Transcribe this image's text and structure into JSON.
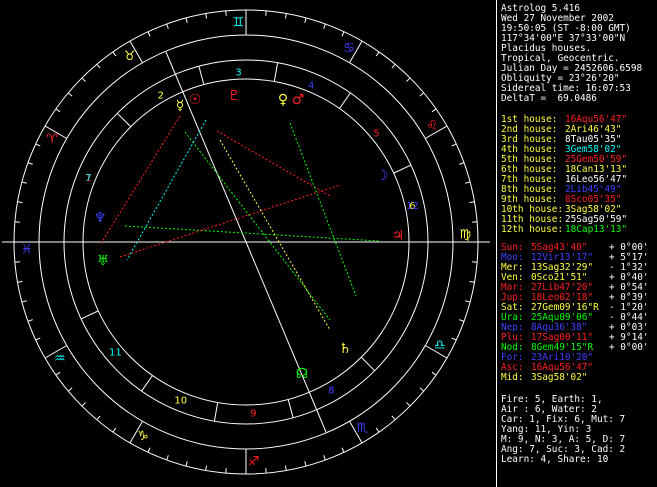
{
  "info_lines": [
    "Astrolog 5.416",
    "Wed 27 November 2002",
    "19:50:05 (ST -8:00 GMT)",
    "117°34'00\"E 37°33'00\"N",
    "Placidus houses.",
    "Tropical, Geocentric.",
    "Julian Day = 2452606.6598",
    "Obliquity = 23°26'20\"",
    "Sidereal time: 16:07:53",
    "DeltaT =  69.0486"
  ],
  "houses": [
    {
      "label": "1st house:",
      "value": "16Aqu56'47\"",
      "color": "#ff2020"
    },
    {
      "label": "2nd house:",
      "value": "2Ari46'43\"",
      "color": "#ffff40"
    },
    {
      "label": "3rd house:",
      "value": "8Tau05'35\"",
      "color": "#ffffff"
    },
    {
      "label": "4th house:",
      "value": "3Gem58'02\"",
      "color": "#00ffff"
    },
    {
      "label": "5th house:",
      "value": "25Gem50'59\"",
      "color": "#ff2020"
    },
    {
      "label": "6th house:",
      "value": "18Can13'13\"",
      "color": "#ffff40"
    },
    {
      "label": "7th house:",
      "value": "16Leo56'47\"",
      "color": "#ffffff"
    },
    {
      "label": "8th house:",
      "value": "2Lib45'49\"",
      "color": "#4040ff"
    },
    {
      "label": "9th house:",
      "value": "8Sco05'35\"",
      "color": "#ff2020"
    },
    {
      "label": "10th house:",
      "value": "3Sag58'02\"",
      "color": "#ffff40"
    },
    {
      "label": "11th house:",
      "value": "25Sag50'59\"",
      "color": "#ffffff"
    },
    {
      "label": "12th house:",
      "value": "18Cap13'13\"",
      "color": "#00ff00"
    }
  ],
  "planets": [
    {
      "name": "Sun:",
      "pos": "5Sag43'40\"",
      "lat": "+ 0°00'",
      "color": "#ff2020"
    },
    {
      "name": "Moo:",
      "pos": "12Vir13'17\"",
      "lat": "+ 5°17'",
      "color": "#4040ff"
    },
    {
      "name": "Mer:",
      "pos": "13Sag32'29\"",
      "lat": "- 1°32'",
      "color": "#ffff40"
    },
    {
      "name": "Ven:",
      "pos": "0Sco21'51\"",
      "lat": "+ 0°40'",
      "color": "#ffff40"
    },
    {
      "name": "Mar:",
      "pos": "27Lib47'20\"",
      "lat": "+ 0°54'",
      "color": "#ff2020"
    },
    {
      "name": "Jup:",
      "pos": "18Leo02'18\"",
      "lat": "+ 0°39'",
      "color": "#ff2020"
    },
    {
      "name": "Sat:",
      "pos": "27Gem09'16\"R",
      "lat": "- 1°20'",
      "color": "#ffff40"
    },
    {
      "name": "Ura:",
      "pos": "25Aqu09'06\"",
      "lat": "- 0°44'",
      "color": "#00ff00"
    },
    {
      "name": "Nep:",
      "pos": "8Aqu36'38\"",
      "lat": "+ 0°03'",
      "color": "#4040ff"
    },
    {
      "name": "Plu:",
      "pos": "17Sag00'11\"",
      "lat": "+ 9°14'",
      "color": "#ff2020"
    },
    {
      "name": "Nod:",
      "pos": "8Gem49'15\"R",
      "lat": "+ 0°00'",
      "color": "#00ff00"
    },
    {
      "name": "For:",
      "pos": "23Ari10'20\"",
      "lat": "",
      "color": "#4040ff"
    },
    {
      "name": "Asc:",
      "pos": "16Aqu56'47\"",
      "lat": "",
      "color": "#ff2020"
    },
    {
      "name": "Mid:",
      "pos": "3Sag58'02\"",
      "lat": "",
      "color": "#ffff40"
    }
  ],
  "summary_lines": [
    "Fire: 5, Earth: 1,",
    "Air : 6, Water: 2",
    "Car: 1, Fix: 6, Mut: 7",
    "Yang: 11, Yin: 3",
    "M: 9, N: 3, A: 5, D: 7",
    "Ang: 7, Suc: 3, Cad: 2",
    "Learn: 4, Share: 10"
  ],
  "wheel": {
    "house_numbers": [
      "1",
      "2",
      "3",
      "4",
      "5",
      "6",
      "7",
      "8",
      "9",
      "10",
      "11",
      "12"
    ],
    "sign_glyphs": [
      "♈",
      "♉",
      "♊",
      "♋",
      "♌",
      "♍",
      "♎",
      "♏",
      "♐",
      "♑",
      "♒",
      "♓"
    ],
    "sign_colors": [
      "#ff2020",
      "#ffff40",
      "#00ffff",
      "#4040ff",
      "#ff2020",
      "#ffff40",
      "#00ffff",
      "#4040ff",
      "#ff2020",
      "#ffff40",
      "#00ffff",
      "#4040ff"
    ],
    "planet_glyphs": [
      "☉",
      "☽",
      "☿",
      "♀",
      "♂",
      "♃",
      "♄",
      "♅",
      "♆",
      "♇",
      "☊"
    ],
    "planet_glyph_colors": [
      "#ff2020",
      "#4040ff",
      "#ffff40",
      "#ffff40",
      "#ff2020",
      "#ff2020",
      "#ffff40",
      "#00ff00",
      "#4040ff",
      "#ff2020",
      "#00ff00"
    ],
    "label_color": "#ffffff",
    "grid_color": "#ffffff",
    "outer_tick_color": "#ffffff"
  }
}
